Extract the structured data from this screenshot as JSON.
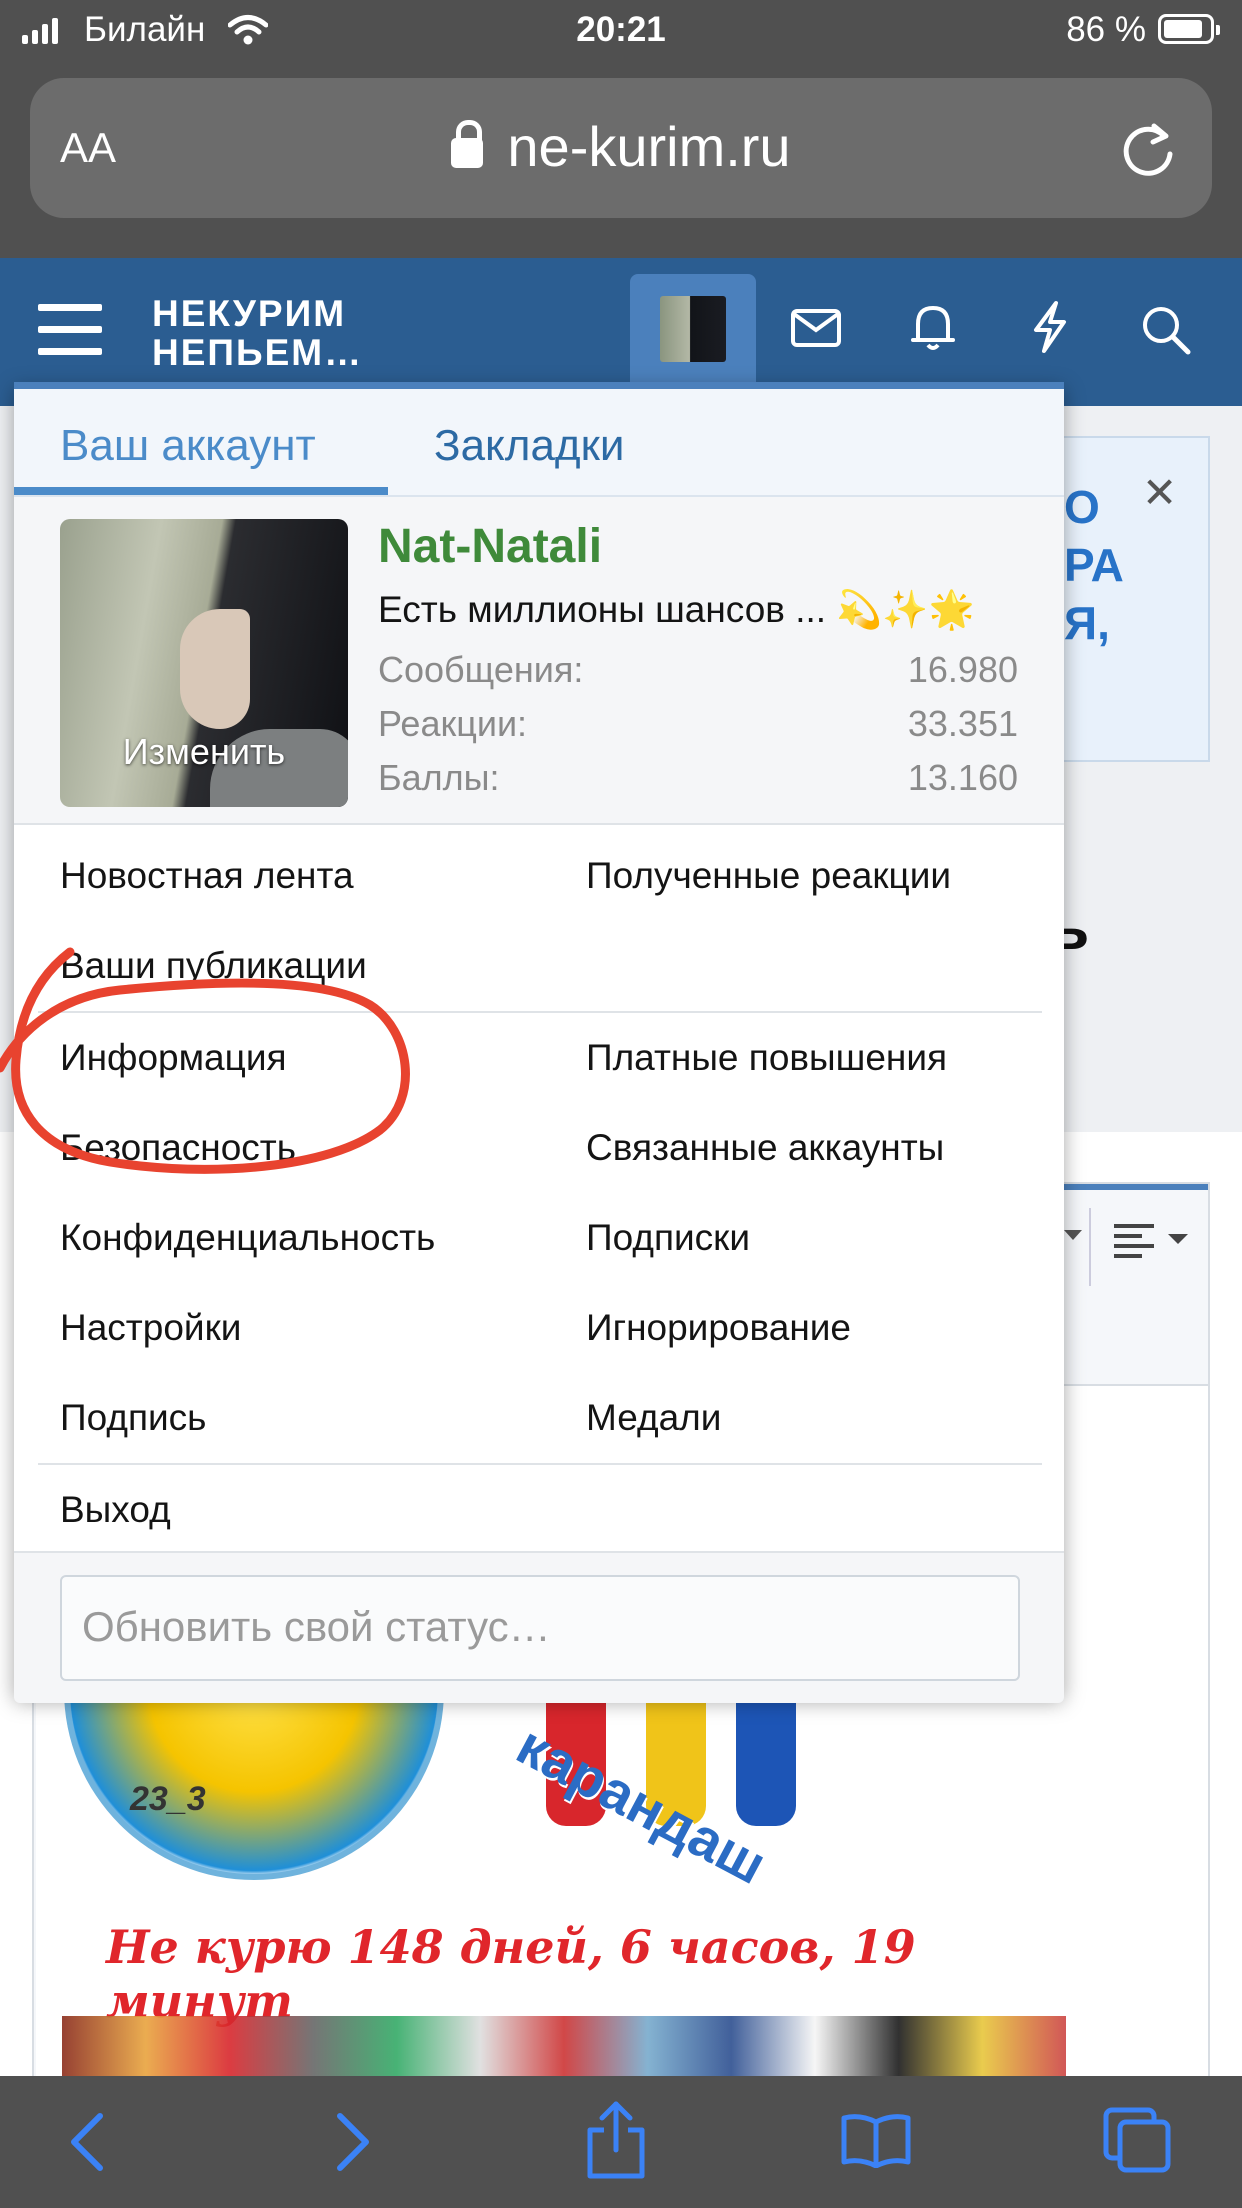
{
  "status_bar": {
    "carrier": "Билайн",
    "time": "20:21",
    "battery": "86 %"
  },
  "browser": {
    "text_size_label": "AA",
    "url": "ne-kurim.ru"
  },
  "site": {
    "logo_line1": "НЕКУРИМ",
    "logo_line2": "НЕПЬЕМ…"
  },
  "menu": {
    "tabs": [
      {
        "label": "Ваш аккаунт",
        "active": true
      },
      {
        "label": "Закладки",
        "active": false
      }
    ],
    "profile": {
      "username": "Nat-Natali",
      "status_text": "Есть миллионы шансов ... 💫✨🌟",
      "avatar_edit": "Изменить",
      "stats": [
        {
          "label": "Сообщения:",
          "value": "16.980"
        },
        {
          "label": "Реакции:",
          "value": "33.351"
        },
        {
          "label": "Баллы:",
          "value": "13.160"
        }
      ]
    },
    "links": {
      "news_feed": "Новостная лента",
      "received_reactions": "Полученные реакции",
      "your_posts": "Ваши публикации",
      "information": "Информация",
      "paid_upgrades": "Платные повышения",
      "security": "Безопасность",
      "connected_accounts": "Связанные аккаунты",
      "privacy": "Конфиденциальность",
      "following": "Подписки",
      "settings": "Настройки",
      "ignoring": "Игнорирование",
      "signature": "Подпись",
      "medals": "Медали",
      "logout": "Выход"
    },
    "status_placeholder": "Обновить свой статус…"
  },
  "background": {
    "banner_text": [
      "О",
      "РА",
      "Я,"
    ],
    "banner_close": "✕",
    "heading_fragment": "ь",
    "signature_badge_label": "23_3",
    "signature_pencil_label": "карандаш",
    "counter_text": "Не курю 148 дней, 6 часов, 19 минут"
  },
  "colors": {
    "header_blue": "#2b5d91",
    "accent_blue": "#4b80bc",
    "username_green": "#3f8a3a",
    "annotation_red": "#e8432f"
  }
}
